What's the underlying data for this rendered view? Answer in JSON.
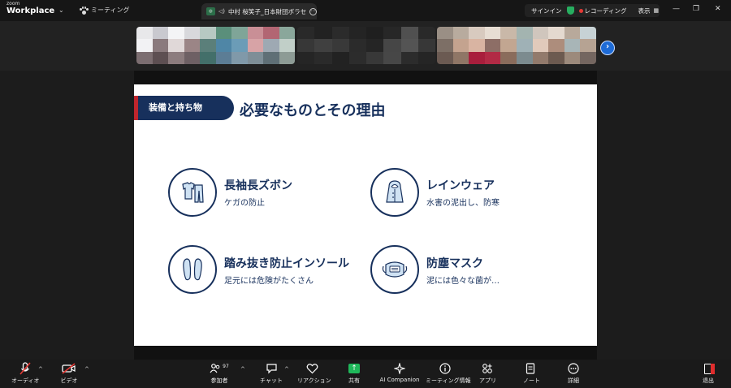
{
  "titlebar": {
    "brand_small": "zoom",
    "brand_big": "Workplace",
    "meeting_tab": "ミーティング",
    "active_tab": "中村 桜笑子_日本財団ボラセ",
    "sign_in": "サインイン",
    "recording": "レコーディング",
    "view": "表示"
  },
  "slide": {
    "section": "装備と持ち物",
    "title": "必要なものとその理由",
    "items": [
      {
        "title": "長袖長ズボン",
        "desc": "ケガの防止",
        "icon": "clothes-icon"
      },
      {
        "title": "レインウェア",
        "desc": "水害の泥出し、防寒",
        "icon": "raincoat-icon"
      },
      {
        "title": "踏み抜き防止インソール",
        "desc": "足元には危険がたくさん",
        "icon": "insole-icon"
      },
      {
        "title": "防塵マスク",
        "desc": "泥には色々な菌が…",
        "icon": "mask-icon"
      }
    ]
  },
  "toolbar": {
    "audio": "オーディオ",
    "video": "ビデオ",
    "participants": "参加者",
    "participants_count": "97",
    "chat": "チャット",
    "reactions": "リアクション",
    "share": "共有",
    "ai": "AI Companion",
    "info": "ミーティング情報",
    "apps": "アプリ",
    "notes": "ノート",
    "more": "詳細",
    "leave": "退出"
  },
  "colors": {
    "navy": "#17305c",
    "accent_red": "#c0262d",
    "share_green": "#1fb85a",
    "next_blue": "#1e6bd6"
  }
}
